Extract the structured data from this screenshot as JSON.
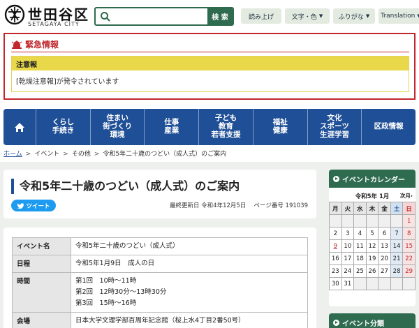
{
  "header": {
    "logo_name": "世田谷区",
    "logo_sub": "SETAGAYA CITY",
    "search": {
      "placeholder": "",
      "button_label": "検 索"
    },
    "tools": [
      {
        "label": "読み上げ",
        "dropdown": false
      },
      {
        "label": "文字・色",
        "dropdown": true
      },
      {
        "label": "ふりがな",
        "dropdown": true
      },
      {
        "label": "Translation",
        "dropdown": true
      }
    ]
  },
  "emergency": {
    "title": "緊急情報",
    "notice_label": "注意報",
    "notice_text": "[乾燥注意報]が発令されています"
  },
  "nav": {
    "items": [
      "くらし\n手続き",
      "住まい\n街づくり\n環境",
      "仕事\n産業",
      "子ども\n教育\n若者支援",
      "福祉\n健康",
      "文化\nスポーツ\n生涯学習",
      "区政情報"
    ]
  },
  "breadcrumb": [
    "ホーム",
    "イベント",
    "その他",
    "令和5年二十歳のつどい（成人式）のご案内"
  ],
  "page": {
    "title": "令和5年二十歳のつどい（成人式）のご案内",
    "tweet_label": "ツイート",
    "updated": "最終更新日 令和4年12月5日",
    "page_number": "ページ番号 191039"
  },
  "info_table": {
    "rows": [
      {
        "key": "イベント名",
        "lines": [
          "令和5年二十歳のつどい（成人式）"
        ]
      },
      {
        "key": "日程",
        "lines": [
          "令和5年1月9日　成人の日"
        ]
      },
      {
        "key": "時間",
        "lines": [
          "第1回　10時～11時",
          "第2回　12時30分～13時30分",
          "第3回　15時～16時"
        ]
      },
      {
        "key": "会場",
        "lines": [
          "日本大学文理学部百周年記念館（桜上水4丁目2番50号）"
        ]
      }
    ]
  },
  "sidebar": {
    "calendar": {
      "heading": "イベントカレンダー",
      "month": "令和5年 1月",
      "next_label": "次月",
      "weekdays": [
        "月",
        "火",
        "水",
        "木",
        "金",
        "土",
        "日"
      ],
      "weeks": [
        [
          "",
          "",
          "",
          "",
          "",
          "",
          "1"
        ],
        [
          "2",
          "3",
          "4",
          "5",
          "6",
          "7",
          "8"
        ],
        [
          "9",
          "10",
          "11",
          "12",
          "13",
          "14",
          "15"
        ],
        [
          "16",
          "17",
          "18",
          "19",
          "20",
          "21",
          "22"
        ],
        [
          "23",
          "24",
          "25",
          "26",
          "27",
          "28",
          "29"
        ],
        [
          "30",
          "31",
          "",
          "",
          "",
          "",
          ""
        ]
      ]
    },
    "category_heading": "イベント分類"
  }
}
